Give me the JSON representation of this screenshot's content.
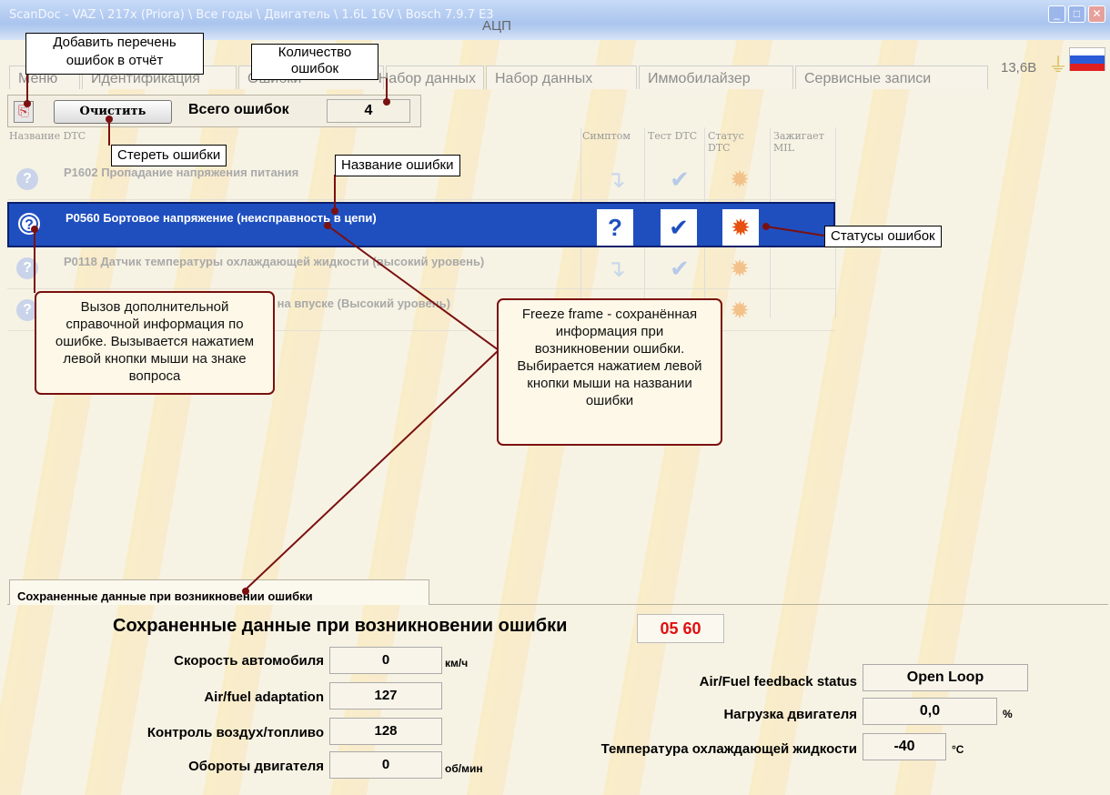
{
  "window": {
    "title": "ScanDoc - VAZ \\ 217x (Priora) \\ Все годы \\ Двигатель \\ 1.6L 16V \\ Bosch 7.9.7 E3",
    "section": "АЦП",
    "voltage": "13,6В"
  },
  "tabs": [
    "Меню",
    "Идентификация",
    "Ошибки",
    "Набор данных",
    "Набор данных",
    "Иммобилайзер",
    "Сервисные записи"
  ],
  "toolbar": {
    "clear_label": "Очистить",
    "total_label": "Всего ошибок",
    "total_value": "4"
  },
  "grid": {
    "headers": {
      "name": "Название DTC",
      "symptom": "Симптом",
      "test": "Тест DTC",
      "status": "Статус DTC",
      "mil": "Зажигает MIL"
    },
    "rows": [
      {
        "code": "P1602 Пропадание напряжения питания"
      },
      {
        "code": "P0560 Бортовое напряжение (неисправность в цепи)"
      },
      {
        "code": "P0118 Датчик температуры охлаждающей жидкости (высокий уровень)"
      },
      {
        "code": "P0113 Датчик температуры воздуха на впуске (Высокий уровень)"
      }
    ]
  },
  "callouts": {
    "add_report": "Добавить перечень ошибок в отчёт",
    "count": "Количество ошибок",
    "erase": "Стереть ошибки",
    "name": "Название ошибки",
    "statuses": "Статусы ошибок",
    "help": "Вызов дополнительной справочной информация по ошибке. Вызывается нажатием левой кнопки мыши на знаке вопроса",
    "freeze": "Freeze frame - сохранённая информация при возникновении ошибки. Выбирается нажатием левой кнопки мыши на названии ошибки"
  },
  "freeze_frame": {
    "tab_label": "Сохраненные данные при возникновении ошибки",
    "title": "Сохраненные данные при возникновении ошибки",
    "code": "05 60",
    "left": [
      {
        "label": "Скорость автомобиля",
        "value": "0",
        "unit": "км/ч"
      },
      {
        "label": "Air/fuel adaptation",
        "value": "127",
        "unit": ""
      },
      {
        "label": "Контроль воздух/топливо",
        "value": "128",
        "unit": ""
      },
      {
        "label": "Обороты двигателя",
        "value": "0",
        "unit": "об/мин"
      }
    ],
    "right": [
      {
        "label": "Air/Fuel  feedback status",
        "value": "Open Loop",
        "unit": ""
      },
      {
        "label": "Нагрузка двигателя",
        "value": "0,0",
        "unit": "%"
      },
      {
        "label": "Температура охлаждающей жидкости",
        "value": "-40",
        "unit": "°C"
      }
    ]
  },
  "colors": {
    "selection": "#1f4fbf",
    "callout_border": "#7a1010",
    "code_red": "#e01010"
  }
}
